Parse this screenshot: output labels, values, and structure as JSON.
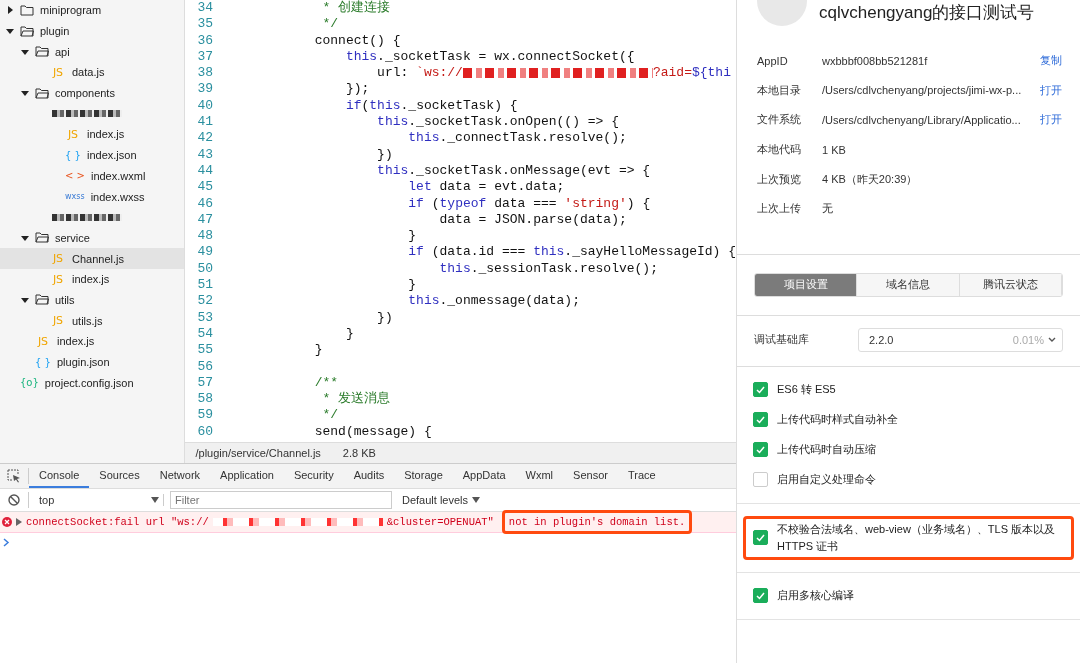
{
  "file_tree": [
    {
      "name": "miniprogram",
      "kind": "folder",
      "expanded": false,
      "selected": false
    },
    {
      "name": "plugin",
      "kind": "folder",
      "expanded": true,
      "selected": false,
      "children": [
        {
          "name": "api",
          "kind": "folder",
          "expanded": true,
          "selected": false,
          "children": [
            {
              "name": "data.js",
              "kind": "js",
              "icon": "JS",
              "selected": false
            }
          ]
        },
        {
          "name": "components",
          "kind": "folder",
          "expanded": true,
          "selected": false,
          "children": [
            {
              "kind": "redacted",
              "selected": false,
              "children": [
                {
                  "name": "index.js",
                  "kind": "js",
                  "icon": "JS",
                  "selected": false
                },
                {
                  "name": "index.json",
                  "kind": "json",
                  "icon": "{ }",
                  "selected": false
                },
                {
                  "name": "index.wxml",
                  "kind": "wxml",
                  "icon": "< >",
                  "selected": false
                },
                {
                  "name": "index.wxss",
                  "kind": "wxss",
                  "icon": "wxss",
                  "selected": false
                }
              ]
            },
            {
              "kind": "redacted",
              "selected": false
            }
          ]
        },
        {
          "name": "service",
          "kind": "folder",
          "expanded": true,
          "selected": false,
          "children": [
            {
              "name": "Channel.js",
              "kind": "js",
              "icon": "JS",
              "selected": true
            },
            {
              "name": "index.js",
              "kind": "js",
              "icon": "JS",
              "selected": false
            }
          ]
        },
        {
          "name": "utils",
          "kind": "folder",
          "expanded": true,
          "selected": false,
          "children": [
            {
              "name": "utils.js",
              "kind": "js",
              "icon": "JS",
              "selected": false
            }
          ]
        },
        {
          "name": "index.js",
          "kind": "js",
          "icon": "JS",
          "selected": false
        },
        {
          "name": "plugin.json",
          "kind": "json",
          "icon": "{ }",
          "selected": false
        }
      ]
    },
    {
      "name": "project.config.json",
      "kind": "config",
      "icon": "{o}",
      "selected": false
    }
  ],
  "editor": {
    "lines": [
      {
        "number": "34",
        "tokens": [
          {
            "text": "     * 创建连接",
            "kind": "comment"
          }
        ]
      },
      {
        "number": "35",
        "tokens": [
          {
            "text": "     */",
            "kind": "comment"
          }
        ]
      },
      {
        "number": "36",
        "tokens": [
          {
            "text": "    connect() {",
            "kind": "plain"
          }
        ]
      },
      {
        "number": "37",
        "tokens": [
          {
            "text": "        this",
            "kind": "keyword"
          },
          {
            "text": "._socketTask = wx.connectSocket({",
            "kind": "plain"
          }
        ]
      },
      {
        "number": "38",
        "tokens": [
          {
            "text": "            url: ",
            "kind": "plain"
          },
          {
            "text": "`ws://",
            "kind": "string"
          },
          {
            "kind": "redacted"
          },
          {
            "text": "?aid=",
            "kind": "string"
          },
          {
            "text": "${thi",
            "kind": "keyword"
          }
        ]
      },
      {
        "number": "39",
        "tokens": [
          {
            "text": "        });",
            "kind": "plain"
          }
        ]
      },
      {
        "number": "40",
        "tokens": [
          {
            "text": "        if",
            "kind": "keyword"
          },
          {
            "text": "(",
            "kind": "plain"
          },
          {
            "text": "this",
            "kind": "keyword"
          },
          {
            "text": "._socketTask) {",
            "kind": "plain"
          }
        ]
      },
      {
        "number": "41",
        "tokens": [
          {
            "text": "            this",
            "kind": "keyword"
          },
          {
            "text": "._socketTask.onOpen(() => {",
            "kind": "plain"
          }
        ]
      },
      {
        "number": "42",
        "tokens": [
          {
            "text": "                this",
            "kind": "keyword"
          },
          {
            "text": "._connectTask.resolve();",
            "kind": "plain"
          }
        ]
      },
      {
        "number": "43",
        "tokens": [
          {
            "text": "            })",
            "kind": "plain"
          }
        ]
      },
      {
        "number": "44",
        "tokens": [
          {
            "text": "            this",
            "kind": "keyword"
          },
          {
            "text": "._socketTask.onMessage(evt => {",
            "kind": "plain"
          }
        ]
      },
      {
        "number": "45",
        "tokens": [
          {
            "text": "                let",
            "kind": "keyword"
          },
          {
            "text": " data = evt.data;",
            "kind": "plain"
          }
        ]
      },
      {
        "number": "46",
        "tokens": [
          {
            "text": "                if",
            "kind": "keyword"
          },
          {
            "text": " (",
            "kind": "plain"
          },
          {
            "text": "typeof",
            "kind": "keyword"
          },
          {
            "text": " data === ",
            "kind": "plain"
          },
          {
            "text": "'string'",
            "kind": "string"
          },
          {
            "text": ") {",
            "kind": "plain"
          }
        ]
      },
      {
        "number": "47",
        "tokens": [
          {
            "text": "                    data = JSON.parse(data);",
            "kind": "plain"
          }
        ]
      },
      {
        "number": "48",
        "tokens": [
          {
            "text": "                }",
            "kind": "plain"
          }
        ]
      },
      {
        "number": "49",
        "tokens": [
          {
            "text": "                if",
            "kind": "keyword"
          },
          {
            "text": " (data.id === ",
            "kind": "plain"
          },
          {
            "text": "this",
            "kind": "keyword"
          },
          {
            "text": "._sayHelloMessageId) {",
            "kind": "plain"
          }
        ]
      },
      {
        "number": "50",
        "tokens": [
          {
            "text": "                    this",
            "kind": "keyword"
          },
          {
            "text": "._sessionTask.resolve();",
            "kind": "plain"
          }
        ]
      },
      {
        "number": "51",
        "tokens": [
          {
            "text": "                }",
            "kind": "plain"
          }
        ]
      },
      {
        "number": "52",
        "tokens": [
          {
            "text": "                this",
            "kind": "keyword"
          },
          {
            "text": "._onmessage(data);",
            "kind": "plain"
          }
        ]
      },
      {
        "number": "53",
        "tokens": [
          {
            "text": "            })",
            "kind": "plain"
          }
        ]
      },
      {
        "number": "54",
        "tokens": [
          {
            "text": "        }",
            "kind": "plain"
          }
        ]
      },
      {
        "number": "55",
        "tokens": [
          {
            "text": "    }",
            "kind": "plain"
          }
        ]
      },
      {
        "number": "56"
      },
      {
        "number": "57",
        "tokens": [
          {
            "text": "    /**",
            "kind": "comment"
          }
        ]
      },
      {
        "number": "58",
        "tokens": [
          {
            "text": "     * 发送消息",
            "kind": "comment"
          }
        ]
      },
      {
        "number": "59",
        "tokens": [
          {
            "text": "     */",
            "kind": "comment"
          }
        ]
      },
      {
        "number": "60",
        "tokens": [
          {
            "text": "    send(message) {",
            "kind": "plain"
          }
        ]
      }
    ],
    "status": {
      "path": "/plugin/service/Channel.js",
      "size": "2.8 KB"
    }
  },
  "devtools": {
    "tabs": [
      {
        "label": "Console",
        "selected": true
      },
      {
        "label": "Sources",
        "selected": false
      },
      {
        "label": "Network",
        "selected": false
      },
      {
        "label": "Application",
        "selected": false
      },
      {
        "label": "Security",
        "selected": false
      },
      {
        "label": "Audits",
        "selected": false
      },
      {
        "label": "Storage",
        "selected": false
      },
      {
        "label": "AppData",
        "selected": false
      },
      {
        "label": "Wxml",
        "selected": false
      },
      {
        "label": "Sensor",
        "selected": false
      },
      {
        "label": "Trace",
        "selected": false
      }
    ],
    "context": "top",
    "filter_placeholder": "Filter",
    "levels": "Default levels",
    "messages": [
      {
        "kind": "error",
        "segments": [
          {
            "kind": "text",
            "text": "connectSocket:fail url \"ws://"
          },
          {
            "kind": "redacted"
          },
          {
            "kind": "text",
            "text": "&cluster=OPENUAT\""
          }
        ],
        "highlighted_note": "not in plugin's domain list."
      }
    ]
  },
  "project_panel": {
    "title": "cqlvchengyang的接口测试号",
    "info": [
      {
        "label": "AppID",
        "value": "wxbbbf008bb521281f",
        "action": "复制"
      },
      {
        "label": "本地目录",
        "value": "/Users/cdlvchenyang/projects/jimi-wx-p...",
        "action": "打开"
      },
      {
        "label": "文件系统",
        "value": "/Users/cdlvchenyang/Library/Applicatio...",
        "action": "打开"
      },
      {
        "label": "本地代码",
        "value": "1 KB"
      },
      {
        "label": "上次预览",
        "value": "4 KB（昨天20:39）"
      },
      {
        "label": "上次上传",
        "value": "无"
      }
    ],
    "tabs": [
      {
        "label": "项目设置",
        "selected": true
      },
      {
        "label": "域名信息",
        "selected": false
      },
      {
        "label": "腾讯云状态",
        "selected": false
      }
    ],
    "library": {
      "label": "调试基础库",
      "version": "2.2.0",
      "share": "0.01%"
    },
    "option_groups": [
      {
        "highlighted": false,
        "options": [
          {
            "label": "ES6 转 ES5",
            "checked": true
          },
          {
            "label": "上传代码时样式自动补全",
            "checked": true
          },
          {
            "label": "上传代码时自动压缩",
            "checked": true
          },
          {
            "label": "启用自定义处理命令",
            "checked": false
          }
        ]
      },
      {
        "highlighted": true,
        "options": [
          {
            "label": "不校验合法域名、web-view（业务域名）、TLS 版本以及 HTTPS 证书",
            "checked": true
          }
        ]
      },
      {
        "highlighted": false,
        "options": [
          {
            "label": "启用多核心编译",
            "checked": true
          }
        ]
      }
    ]
  }
}
